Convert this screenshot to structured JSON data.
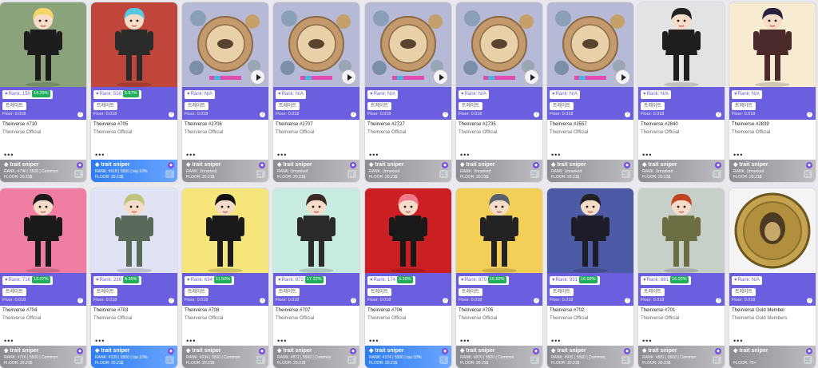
{
  "colors": {
    "accent": "#6b5fe0",
    "percent_badge": "#1fae5b",
    "sniper_gray": "#9a9aa0",
    "sniper_blue": "#3b82f6"
  },
  "trait_label": "트레이트",
  "sniper_title": "trait sniper",
  "more_label": "•••",
  "icons": {
    "heart": "heart-icon",
    "play": "play-icon",
    "cart": "cart-icon",
    "diamond": "diamond-icon",
    "info": "info-icon"
  },
  "cards": [
    {
      "rank": "Rank: 150",
      "pct": "14.29%",
      "floor": "Floor: 0.018",
      "name": "Theirverse #710",
      "collection": "Theirverse Official",
      "s_rank": "RANK: #746 | 5500 | Common",
      "s_floor": "FLOOR: 20.21$",
      "blue": false,
      "bg": "#8aa37a"
    },
    {
      "rank": "Rank: 518",
      "pct": "5.67%",
      "floor": "Floor: 0.018",
      "name": "Theirverse #705",
      "collection": "Theirverse Official",
      "s_rank": "RANK: #518 | 5500 | top 10%",
      "s_floor": "FLOOR: 20.21$",
      "blue": true,
      "bg": "#c0463c"
    },
    {
      "rank": "Rank: N/A",
      "pct": "",
      "floor": "Floor: 0.018",
      "name": "Theirverse #2708",
      "collection": "Theirverse Official",
      "s_rank": "RANK: Unranked",
      "s_floor": "FLOOR: 20.21$",
      "blue": false,
      "bg": "#b6bad6"
    },
    {
      "rank": "Rank: N/A",
      "pct": "",
      "floor": "Floor: 0.018",
      "name": "Theirverse #2707",
      "collection": "Theirverse Official",
      "s_rank": "RANK: Unranked",
      "s_floor": "FLOOR: 20.21$",
      "blue": false,
      "bg": "#b6bad6"
    },
    {
      "rank": "Rank: N/A",
      "pct": "",
      "floor": "Floor: 0.018",
      "name": "Theirverse #2727",
      "collection": "Theirverse Official",
      "s_rank": "RANK: Unranked",
      "s_floor": "FLOOR: 20.21$",
      "blue": false,
      "bg": "#b6bad6"
    },
    {
      "rank": "Rank: N/A",
      "pct": "",
      "floor": "Floor: 0.018",
      "name": "Theirverse #2735",
      "collection": "Theirverse Official",
      "s_rank": "RANK: Unranked",
      "s_floor": "FLOOR: 20.21$",
      "blue": false,
      "bg": "#b6bad6"
    },
    {
      "rank": "Rank: N/A",
      "pct": "",
      "floor": "Floor: 0.018",
      "name": "Theirverse #2557",
      "collection": "Theirverse Official",
      "s_rank": "RANK: Unranked",
      "s_floor": "FLOOR: 20.21$",
      "blue": false,
      "bg": "#b6bad6"
    },
    {
      "rank": "Rank: N/A",
      "pct": "",
      "floor": "Floor: 0.018",
      "name": "Theirverse #2840",
      "collection": "Theirverse Official",
      "s_rank": "RANK: Unranked",
      "s_floor": "FLOOR: 20.21$",
      "blue": false,
      "bg": "#e3e3e6"
    },
    {
      "rank": "Rank: N/A",
      "pct": "",
      "floor": "Floor: 0.018",
      "name": "Theirverse #2839",
      "collection": "Theirverse Official",
      "s_rank": "RANK: Unranked",
      "s_floor": "FLOOR: 20.21$",
      "blue": false,
      "bg": "#f7ecd2"
    },
    {
      "rank": "Rank: 716",
      "pct": "13.07%",
      "floor": "Floor: 0.018",
      "name": "Theirverse #704",
      "collection": "Theirverse Official",
      "s_rank": "RANK: #716 | 5500 | Common",
      "s_floor": "FLOOR: 20.21$",
      "blue": false,
      "bg": "#f07ea2"
    },
    {
      "rank": "Rank: 239",
      "pct": "4.35%",
      "floor": "Floor: 0.018",
      "name": "Theirverse #703",
      "collection": "Theirverse Official",
      "s_rank": "RANK: #239 | 5500 | top 10%",
      "s_floor": "FLOOR: 20.21$",
      "blue": true,
      "bg": "#dfe3f3"
    },
    {
      "rank": "Rank: 634",
      "pct": "11.50%",
      "floor": "Floor: 0.018",
      "name": "Theirverse #708",
      "collection": "Theirverse Official",
      "s_rank": "RANK: #634 | 5500 | Common",
      "s_floor": "FLOOR: 20.21$",
      "blue": false,
      "bg": "#f6e57a"
    },
    {
      "rank": "Rank: 872",
      "pct": "17.22%",
      "floor": "Floor: 0.018",
      "name": "Theirverse #707",
      "collection": "Theirverse Official",
      "s_rank": "RANK: #872 | 5500 | Common",
      "s_floor": "FLOOR: 20.21$",
      "blue": false,
      "bg": "#c9ece2"
    },
    {
      "rank": "Rank: 174",
      "pct": "3.16%",
      "floor": "Floor: 0.018",
      "name": "Theirverse #706",
      "collection": "Theirverse Official",
      "s_rank": "RANK: #174 | 5500 | top 10%",
      "s_floor": "FLOOR: 20.21$",
      "blue": true,
      "bg": "#cc1f24"
    },
    {
      "rank": "Rank: 870",
      "pct": "15.82%",
      "floor": "Floor: 0.018",
      "name": "Theirverse #705",
      "collection": "Theirverse Official",
      "s_rank": "RANK: #870 | 5500 | Common",
      "s_floor": "FLOOR: 20.21$",
      "blue": false,
      "bg": "#f3cf58"
    },
    {
      "rank": "Rank: 931",
      "pct": "16.93%",
      "floor": "Floor: 0.018",
      "name": "Theirverse #702",
      "collection": "Theirverse Official",
      "s_rank": "RANK: #931 | 5500 | Common",
      "s_floor": "FLOOR: 20.21$",
      "blue": false,
      "bg": "#4d5aa6"
    },
    {
      "rank": "Rank: 881",
      "pct": "16.02%",
      "floor": "Floor: 0.018",
      "name": "Theirverse #701",
      "collection": "Theirverse Official",
      "s_rank": "RANK: #881 | 5500 | Common",
      "s_floor": "FLOOR: 20.21$",
      "blue": false,
      "bg": "#c7cfc9"
    },
    {
      "rank": "Rank: N/A",
      "pct": "",
      "floor": "Floor: 0.018",
      "name": "Theirverse Gold Member",
      "collection": "Theirverse Gold Members",
      "s_rank": "",
      "s_floor": "FLOOR: 75+",
      "blue": false,
      "bg": "#f4f4f4"
    }
  ]
}
